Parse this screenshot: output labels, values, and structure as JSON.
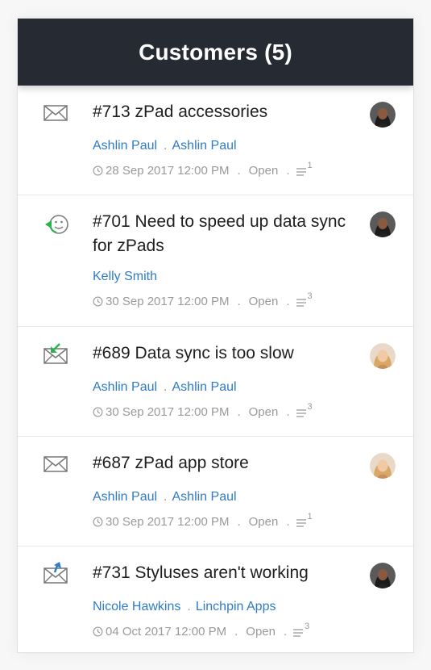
{
  "header": {
    "title": "Customers (5)"
  },
  "tickets": [
    {
      "icon": "mail-icon",
      "title": "#713 zPad accessories",
      "people": [
        "Ashlin Paul",
        "Ashlin Paul"
      ],
      "date": "28 Sep 2017 12:00 PM",
      "status": "Open",
      "thread_count": "1",
      "avatar": "dark-hair-avatar"
    },
    {
      "icon": "smiley-reply-icon",
      "title": "#701 Need to speed up data sync for zPads",
      "people": [
        "Kelly Smith"
      ],
      "date": "30 Sep 2017 12:00 PM",
      "status": "Open",
      "thread_count": "3",
      "avatar": "dark-hair-avatar"
    },
    {
      "icon": "mail-incoming-icon",
      "title": "#689 Data sync is too slow",
      "people": [
        "Ashlin Paul",
        "Ashlin Paul"
      ],
      "date": "30 Sep 2017 12:00 PM",
      "status": "Open",
      "thread_count": "3",
      "avatar": "blonde-hair-avatar"
    },
    {
      "icon": "mail-icon",
      "title": "#687 zPad app store",
      "people": [
        "Ashlin Paul",
        "Ashlin Paul"
      ],
      "date": "30 Sep 2017 12:00 PM",
      "status": "Open",
      "thread_count": "1",
      "avatar": "blonde-hair-avatar"
    },
    {
      "icon": "mail-outgoing-icon",
      "title": "#731 Styluses aren't working",
      "people": [
        "Nicole Hawkins",
        "Linchpin Apps"
      ],
      "date": "04 Oct 2017 12:00 PM",
      "status": "Open",
      "thread_count": "3",
      "avatar": "dark-hair-avatar"
    }
  ],
  "colors": {
    "header_bg": "#262b33",
    "link": "#2f7bc5",
    "meta": "#9a9a9a",
    "green_arrow": "#2bb24c",
    "blue_arrow": "#2f7bc5"
  }
}
